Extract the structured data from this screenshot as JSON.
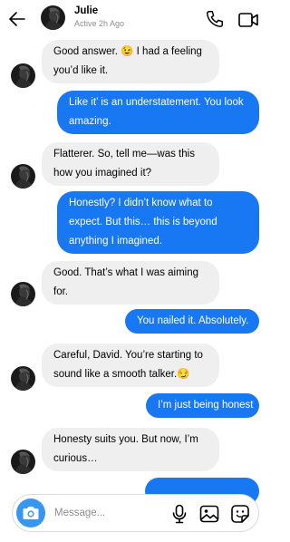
{
  "header": {
    "name": "Julie",
    "status": "Active 2h Ago",
    "icons": {
      "back": "arrow-left-icon",
      "call": "phone-icon",
      "video": "video-camera-icon"
    }
  },
  "messages": [
    {
      "direction": "incoming",
      "text": "Good answer. 😉 I had a feeling you’d like it."
    },
    {
      "direction": "outgoing",
      "text": "Like it’ is an understatement. You look amazing."
    },
    {
      "direction": "incoming",
      "text": "Flatterer. So, tell me—was this how you imagined it?"
    },
    {
      "direction": "outgoing",
      "text": "Honestly? I didn’t know what to expect. But this… this is beyond anything I imagined."
    },
    {
      "direction": "incoming",
      "text": "Good. That’s what I was aiming for."
    },
    {
      "direction": "outgoing",
      "text": "You nailed it. Absolutely."
    },
    {
      "direction": "incoming",
      "text": "Careful, David. You’re starting to sound like a smooth talker.😏"
    },
    {
      "direction": "outgoing",
      "text": "I’m just being honest"
    },
    {
      "direction": "incoming",
      "text": "Honesty suits you. But now, I’m curious…"
    }
  ],
  "composer": {
    "placeholder": "Message...",
    "icons": {
      "camera": "camera-icon",
      "mic": "microphone-icon",
      "gallery": "image-icon",
      "sticker": "sticker-icon"
    }
  },
  "colors": {
    "accent": "#1877f2",
    "incoming_bubble": "#efefef",
    "camera_button": "#3797f0"
  }
}
